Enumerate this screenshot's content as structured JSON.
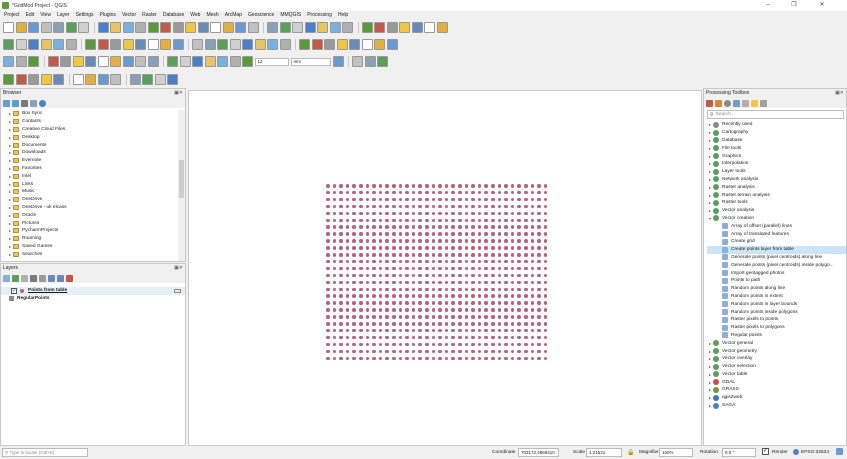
{
  "window": {
    "title": "*GridMod Project - QGIS",
    "controls": [
      "–",
      "❐",
      "✕"
    ]
  },
  "menubar": [
    "Project",
    "Edit",
    "View",
    "Layer",
    "Settings",
    "Plugins",
    "Vector",
    "Raster",
    "Database",
    "Web",
    "Mesh",
    "ArcMap",
    "Geoscience",
    "MMQGIS",
    "Processing",
    "Help"
  ],
  "toolbar": {
    "scale_combo_value": "12",
    "unit_combo_value": "mm"
  },
  "browser": {
    "title": "Browser",
    "items": [
      "Box Sync",
      "Contacts",
      "Creative Cloud Files",
      "Desktop",
      "Documents",
      "Downloads",
      "Evernote",
      "Favorites",
      "Intel",
      "Links",
      "Music",
      "OneDrive",
      "OneDrive - uk elcass",
      "Oracle",
      "Pictures",
      "PycharmProjects",
      "Roaming",
      "Saved Games",
      "Searches"
    ]
  },
  "layers": {
    "title": "Layers",
    "items": [
      {
        "label": "Points from table",
        "checked": true,
        "color": "#b5637a"
      },
      {
        "label": "RegularPoints",
        "checked": false,
        "color": "#888888"
      }
    ]
  },
  "processing": {
    "title": "Processing Toolbox",
    "search_placeholder": "Search...",
    "groups_top": [
      "Recently used",
      "Cartography",
      "Database",
      "File tools",
      "Graphics",
      "Interpolation",
      "Layer tools",
      "Network analysis",
      "Raster analysis",
      "Raster terrain analysis",
      "Raster tools",
      "Vector analysis",
      "Vector creation"
    ],
    "vector_creation_items": [
      "Array of offset (parallel) lines",
      "Array of translated features",
      "Create grid",
      "Create points layer from table",
      "Generate points (pixel centroids) along line",
      "Generate points (pixel centroids) inside polygo...",
      "Import geotagged photos",
      "Points to path",
      "Random points along line",
      "Random points in extent",
      "Random points in layer bounds",
      "Random points inside polygons",
      "Raster pixels to points",
      "Raster pixels to polygons",
      "Regular points"
    ],
    "selected_item": "Create points layer from table",
    "groups_bottom": [
      "Vector general",
      "Vector geometry",
      "Vector overlay",
      "Vector selection",
      "Vector table",
      "GDAL",
      "GRASS",
      "qgis2web",
      "SAGA"
    ]
  },
  "statusbar": {
    "locator_placeholder": "Type to locate (Ctrl+K)",
    "coordinate_label": "Coordinate",
    "coordinate_value": "703172,4868410",
    "scale_label": "Scale",
    "scale_value": "1:21531",
    "magnifier_label": "Magnifier",
    "magnifier_value": "100%",
    "rotation_label": "Rotation",
    "rotation_value": "0.0 °",
    "render_label": "Render",
    "crs_label": "EPSG:32634"
  },
  "colors": {
    "point_fill": "#b5637a",
    "selection": "#cce4f7",
    "accent": "#3875d7"
  }
}
